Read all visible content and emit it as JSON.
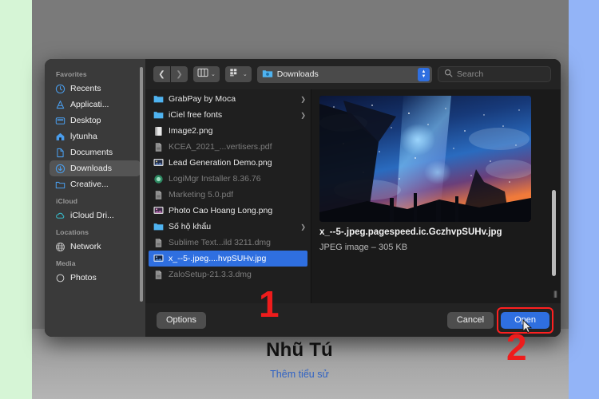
{
  "window": {
    "title": "Open File Dialog",
    "background_colors": {
      "left": "#d6f5d6",
      "right": "#93b4f7",
      "page": "#7a7a7a"
    },
    "accent": "#2f6fe0",
    "annotation_color": "#ee1c1c"
  },
  "toolbar": {
    "back_icon": "chevron-left-icon",
    "forward_icon": "chevron-right-icon",
    "view_icon": "column-view-icon",
    "group_icon": "group-by-icon",
    "chevron": "⌄",
    "path_label": "Downloads",
    "path_icon": "folder-downloads-icon",
    "stepper_up": "▲",
    "stepper_down": "▼",
    "search_placeholder": "Search",
    "search_icon": "search-icon"
  },
  "sidebar": {
    "groups": [
      {
        "title": "Favorites",
        "items": [
          {
            "label": "Recents",
            "icon": "clock-icon",
            "selected": false
          },
          {
            "label": "Applicati...",
            "icon": "applications-icon",
            "selected": false
          },
          {
            "label": "Desktop",
            "icon": "desktop-icon",
            "selected": false
          },
          {
            "label": "lytunha",
            "icon": "home-icon",
            "selected": false
          },
          {
            "label": "Documents",
            "icon": "document-icon",
            "selected": false
          },
          {
            "label": "Downloads",
            "icon": "downloads-icon",
            "selected": true
          },
          {
            "label": "Creative...",
            "icon": "folder-icon",
            "selected": false
          }
        ]
      },
      {
        "title": "iCloud",
        "items": [
          {
            "label": "iCloud Dri...",
            "icon": "cloud-icon",
            "selected": false
          }
        ]
      },
      {
        "title": "Locations",
        "items": [
          {
            "label": "Network",
            "icon": "globe-icon",
            "selected": false
          }
        ]
      },
      {
        "title": "Media",
        "items": [
          {
            "label": "Photos",
            "icon": "photos-icon",
            "selected": false
          }
        ]
      }
    ]
  },
  "file_list": {
    "items": [
      {
        "name": "GrabPay by Moca",
        "icon": "folder-icon",
        "dimmed": false,
        "selected": false,
        "has_arrow": true
      },
      {
        "name": "iCiel free fonts",
        "icon": "folder-icon",
        "dimmed": false,
        "selected": false,
        "has_arrow": true
      },
      {
        "name": "Image2.png",
        "icon": "image-doc-icon",
        "dimmed": false,
        "selected": false,
        "has_arrow": false
      },
      {
        "name": "KCEA_2021_...vertisers.pdf",
        "icon": "pdf-icon",
        "dimmed": true,
        "selected": false,
        "has_arrow": false
      },
      {
        "name": "Lead Generation Demo.png",
        "icon": "photo-icon",
        "dimmed": false,
        "selected": false,
        "has_arrow": false
      },
      {
        "name": "LogiMgr Installer 8.36.76",
        "icon": "installer-icon",
        "dimmed": true,
        "selected": false,
        "has_arrow": false
      },
      {
        "name": "Marketing 5.0.pdf",
        "icon": "pdf-icon",
        "dimmed": true,
        "selected": false,
        "has_arrow": false
      },
      {
        "name": "Photo Cao Hoang Long.png",
        "icon": "photo-icon",
        "dimmed": false,
        "selected": false,
        "has_arrow": false
      },
      {
        "name": "Số hộ khẩu",
        "icon": "folder-icon",
        "dimmed": false,
        "selected": false,
        "has_arrow": true
      },
      {
        "name": "Sublime Text...ild 3211.dmg",
        "icon": "pdf-icon",
        "dimmed": true,
        "selected": false,
        "has_arrow": false
      },
      {
        "name": "x_--5-.jpeg....hvpSUHv.jpg",
        "icon": "photo-icon",
        "dimmed": false,
        "selected": true,
        "has_arrow": false
      },
      {
        "name": "ZaloSetup-21.3.3.dmg",
        "icon": "pdf-icon",
        "dimmed": true,
        "selected": false,
        "has_arrow": false
      }
    ]
  },
  "preview": {
    "thumbnail_alt": "starry-night-sky-photo",
    "file_name": "x_--5-.jpeg.pagespeed.ic.GczhvpSUHv.jpg",
    "file_meta": "JPEG image – 305 KB"
  },
  "footer": {
    "options_label": "Options",
    "cancel_label": "Cancel",
    "open_label": "Open"
  },
  "annotations": {
    "step_one": "1",
    "step_two": "2"
  },
  "profile": {
    "name": "Nhũ Tú",
    "subtitle": "Thêm tiểu sử"
  }
}
